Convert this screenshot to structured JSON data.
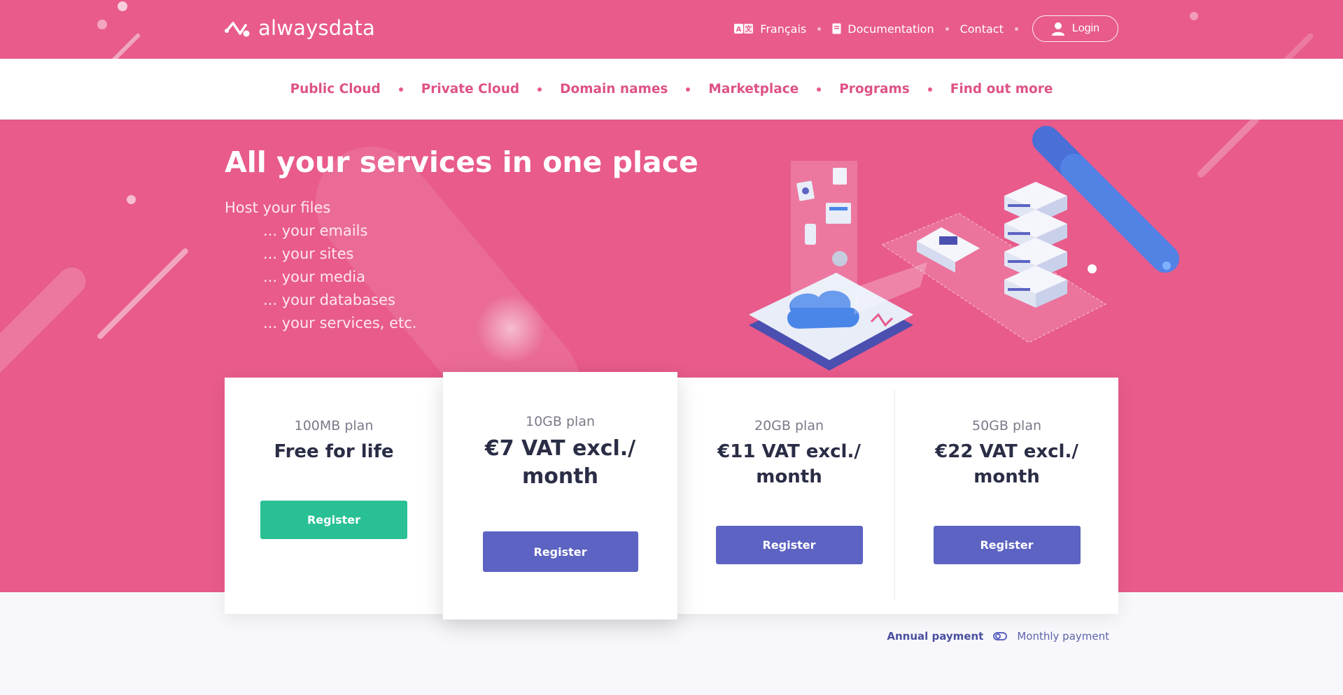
{
  "brand": {
    "name": "alwaysdata"
  },
  "topnav": {
    "language": "Français",
    "documentation": "Documentation",
    "contact": "Contact",
    "login": "Login"
  },
  "mainnav": {
    "items": [
      "Public Cloud",
      "Private Cloud",
      "Domain names",
      "Marketplace",
      "Programs",
      "Find out more"
    ]
  },
  "hero": {
    "title": "All your services in one place",
    "lines": [
      "Host your files",
      "... your emails",
      "... your sites",
      "... your media",
      "... your databases",
      "... your services, etc."
    ]
  },
  "plans": [
    {
      "name": "100MB plan",
      "price": "Free for life",
      "cta": "Register",
      "color": "#2ac096"
    },
    {
      "name": "10GB plan",
      "price_line1": "€7 VAT excl./",
      "price_line2": "month",
      "cta": "Register",
      "color": "#5c63c2"
    },
    {
      "name": "20GB plan",
      "price_line1": "€11 VAT excl./",
      "price_line2": "month",
      "cta": "Register",
      "color": "#5c63c2"
    },
    {
      "name": "50GB plan",
      "price_line1": "€22 VAT excl./",
      "price_line2": "month",
      "cta": "Register",
      "color": "#5c63c2"
    }
  ],
  "billing": {
    "annual": "Annual payment",
    "monthly": "Monthly payment"
  },
  "colors": {
    "hero": "#e85b8b",
    "accent": "#de5287",
    "primary": "#5c63c2",
    "success": "#2ac096"
  }
}
